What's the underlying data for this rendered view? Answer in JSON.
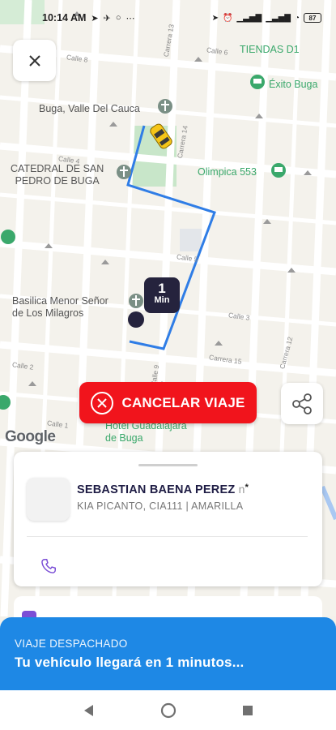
{
  "status_bar": {
    "time": "10:14 AM",
    "icons_left": [
      "navigation-arrow-icon",
      "telegram-icon",
      "messenger-icon",
      "more-dots-icon"
    ],
    "battery": "87"
  },
  "map": {
    "pois": [
      {
        "label": "Buga, Valle Del Cauca",
        "style": "plain"
      },
      {
        "label": "CATEDRAL DE SAN\nPEDRO DE BUGA",
        "style": "plain"
      },
      {
        "label": "Basilica Menor Señor\nde Los Milagros",
        "style": "plain"
      },
      {
        "label": "TIENDAS D1",
        "style": "green"
      },
      {
        "label": "Éxito Buga",
        "style": "green"
      },
      {
        "label": "Olimpica 553",
        "style": "green"
      },
      {
        "label": "Hotel Guadalajara\nde Buga",
        "style": "green"
      }
    ],
    "streets": [
      "Calle 8",
      "Calle 6",
      "Carrera 14",
      "Carrera 13",
      "Calle 4",
      "Calle 5",
      "Calle 3",
      "Calle 2",
      "Calle 1",
      "Carrera 15",
      "Carrera 12",
      "Calle 9"
    ],
    "route_color": "#2f7de6",
    "attribution": "Google"
  },
  "eta_badge": {
    "value": "1",
    "unit": "Min"
  },
  "actions": {
    "cancel_label": "CANCELAR VIAJE",
    "cancel_color": "#f1141c"
  },
  "driver": {
    "name": "SEBASTIAN BAENA PEREZ",
    "name_suffix": "n",
    "name_mark": "*",
    "vehicle": "KIA PICANTO, CIA111 | AMARILLA"
  },
  "banner": {
    "status": "VIAJE DESPACHADO",
    "message": "Tu vehículo llegará en 1 minutos...",
    "color": "#1e88e5"
  },
  "nav": {
    "back": "back-triangle-icon",
    "home": "home-circle-icon",
    "recents": "recents-square-icon"
  }
}
